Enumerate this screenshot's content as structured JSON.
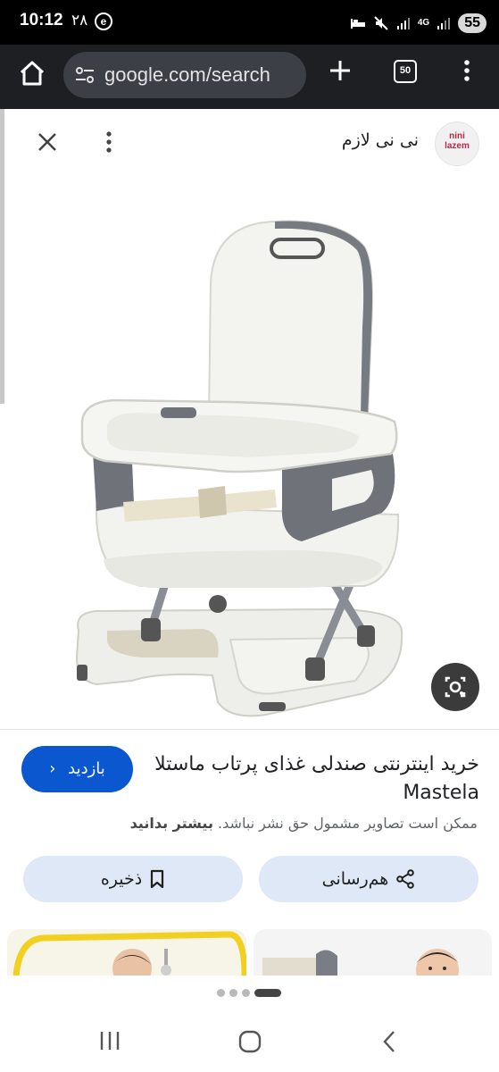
{
  "status_bar": {
    "time": "10:12",
    "date": "۲۸",
    "app_icon_letter": "e",
    "battery": "55",
    "network_label": "4G"
  },
  "browser": {
    "url": "google.com/search",
    "tab_count": "50",
    "icons": [
      "home-icon",
      "tune-icon",
      "plus-icon",
      "tabs-icon",
      "more-vert-icon"
    ]
  },
  "viewer": {
    "source_name": "نی نی لازم",
    "source_logo_text": "nini lazem",
    "title": "خرید اینترنتی صندلی غذای پرتاب ماستلا Mastela",
    "visit_label": "بازدید",
    "copyright_text": "ممکن است تصاویر مشمول حق نشر نباشد.",
    "learn_more": "بیشتر بدانید",
    "share_label": "هم‌رسانی",
    "save_label": "ذخیره",
    "icons": [
      "close-icon",
      "more-vert-icon",
      "lens-icon",
      "chevron-left-icon",
      "share-icon",
      "bookmark-icon"
    ]
  },
  "pager": {
    "count": 4,
    "active_index": 3
  },
  "colors": {
    "visit_button": "#0b57d0",
    "action_button": "#dfe8f7",
    "browser_bar": "#1e1f22",
    "url_pill": "#3c3f46"
  }
}
